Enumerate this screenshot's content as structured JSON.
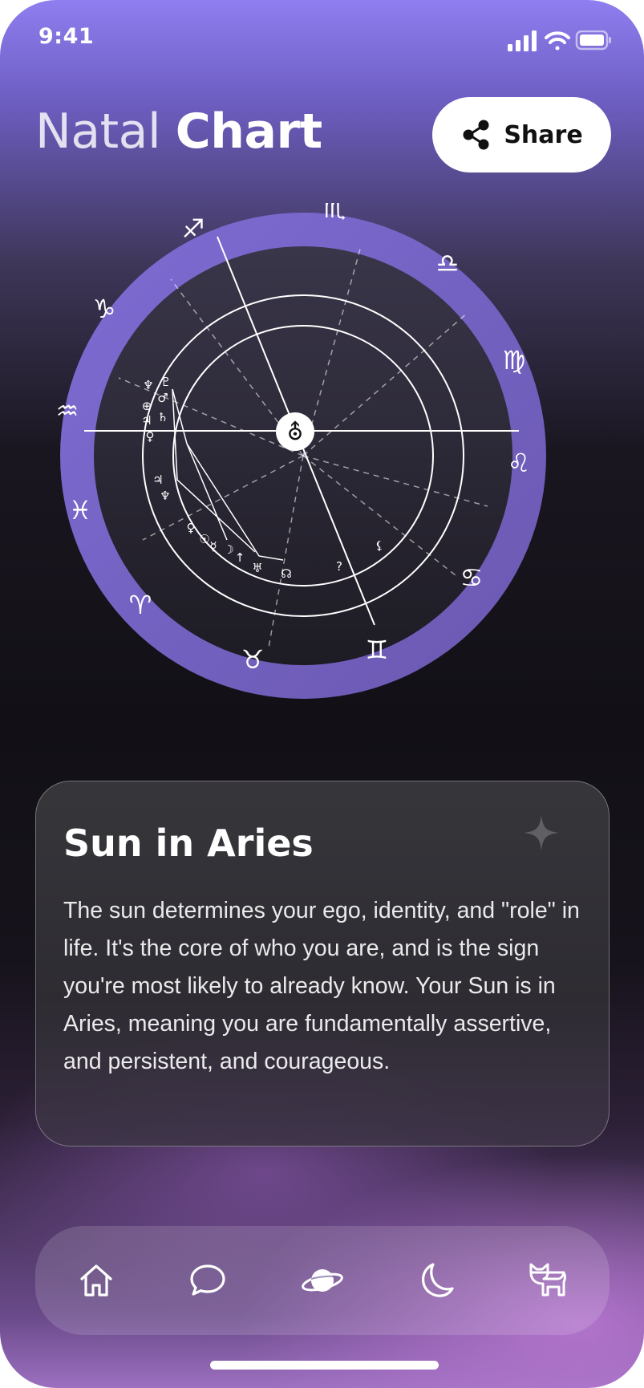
{
  "status_bar": {
    "time": "9:41",
    "icons": [
      "signal-icon",
      "wifi-icon",
      "battery-icon"
    ]
  },
  "header": {
    "title_light": "Natal",
    "title_bold": "Chart",
    "share_label": "Share",
    "share_icon": "share-icon"
  },
  "chart": {
    "zodiac_signs": [
      "Scorpio",
      "Libra",
      "Virgo",
      "Leo",
      "Cancer",
      "Gemini",
      "Taurus",
      "Aries",
      "Pisces",
      "Aquarius",
      "Capricorn",
      "Sagittarius"
    ],
    "zodiac_glyphs": [
      "♏",
      "♎",
      "♍",
      "♌",
      "♋",
      "♊",
      "♉",
      "♈",
      "♓",
      "♒",
      "♑",
      "♐"
    ],
    "center_symbol": "⛢",
    "planet_glyphs": [
      "♆",
      "♇",
      "♂",
      "⊕",
      "♃",
      "♄",
      "♀",
      "♃",
      "♆",
      "♀",
      "☉",
      "☿",
      "☽",
      "↑",
      "♅",
      "☊",
      "?",
      "⚸"
    ],
    "colors": {
      "wheel_ring": "#7b68c8",
      "wheel_inner": "#2a2732",
      "lines": "#ffffff"
    }
  },
  "card": {
    "title": "Sun in Aries",
    "body": "The sun determines your ego, identity, and \"role\" in life. It's the core of who you are, and is the sign you're most likely to already know. Your Sun is in Aries, meaning you are fundamentally  assertive, and persistent, and courageous.",
    "icon": "sparkle-icon"
  },
  "nav": {
    "items": [
      {
        "name": "home",
        "icon": "home-icon"
      },
      {
        "name": "chat",
        "icon": "chat-bubble-icon"
      },
      {
        "name": "planet",
        "icon": "planet-icon"
      },
      {
        "name": "moon",
        "icon": "moon-icon"
      },
      {
        "name": "cat",
        "icon": "cat-icon"
      }
    ]
  }
}
